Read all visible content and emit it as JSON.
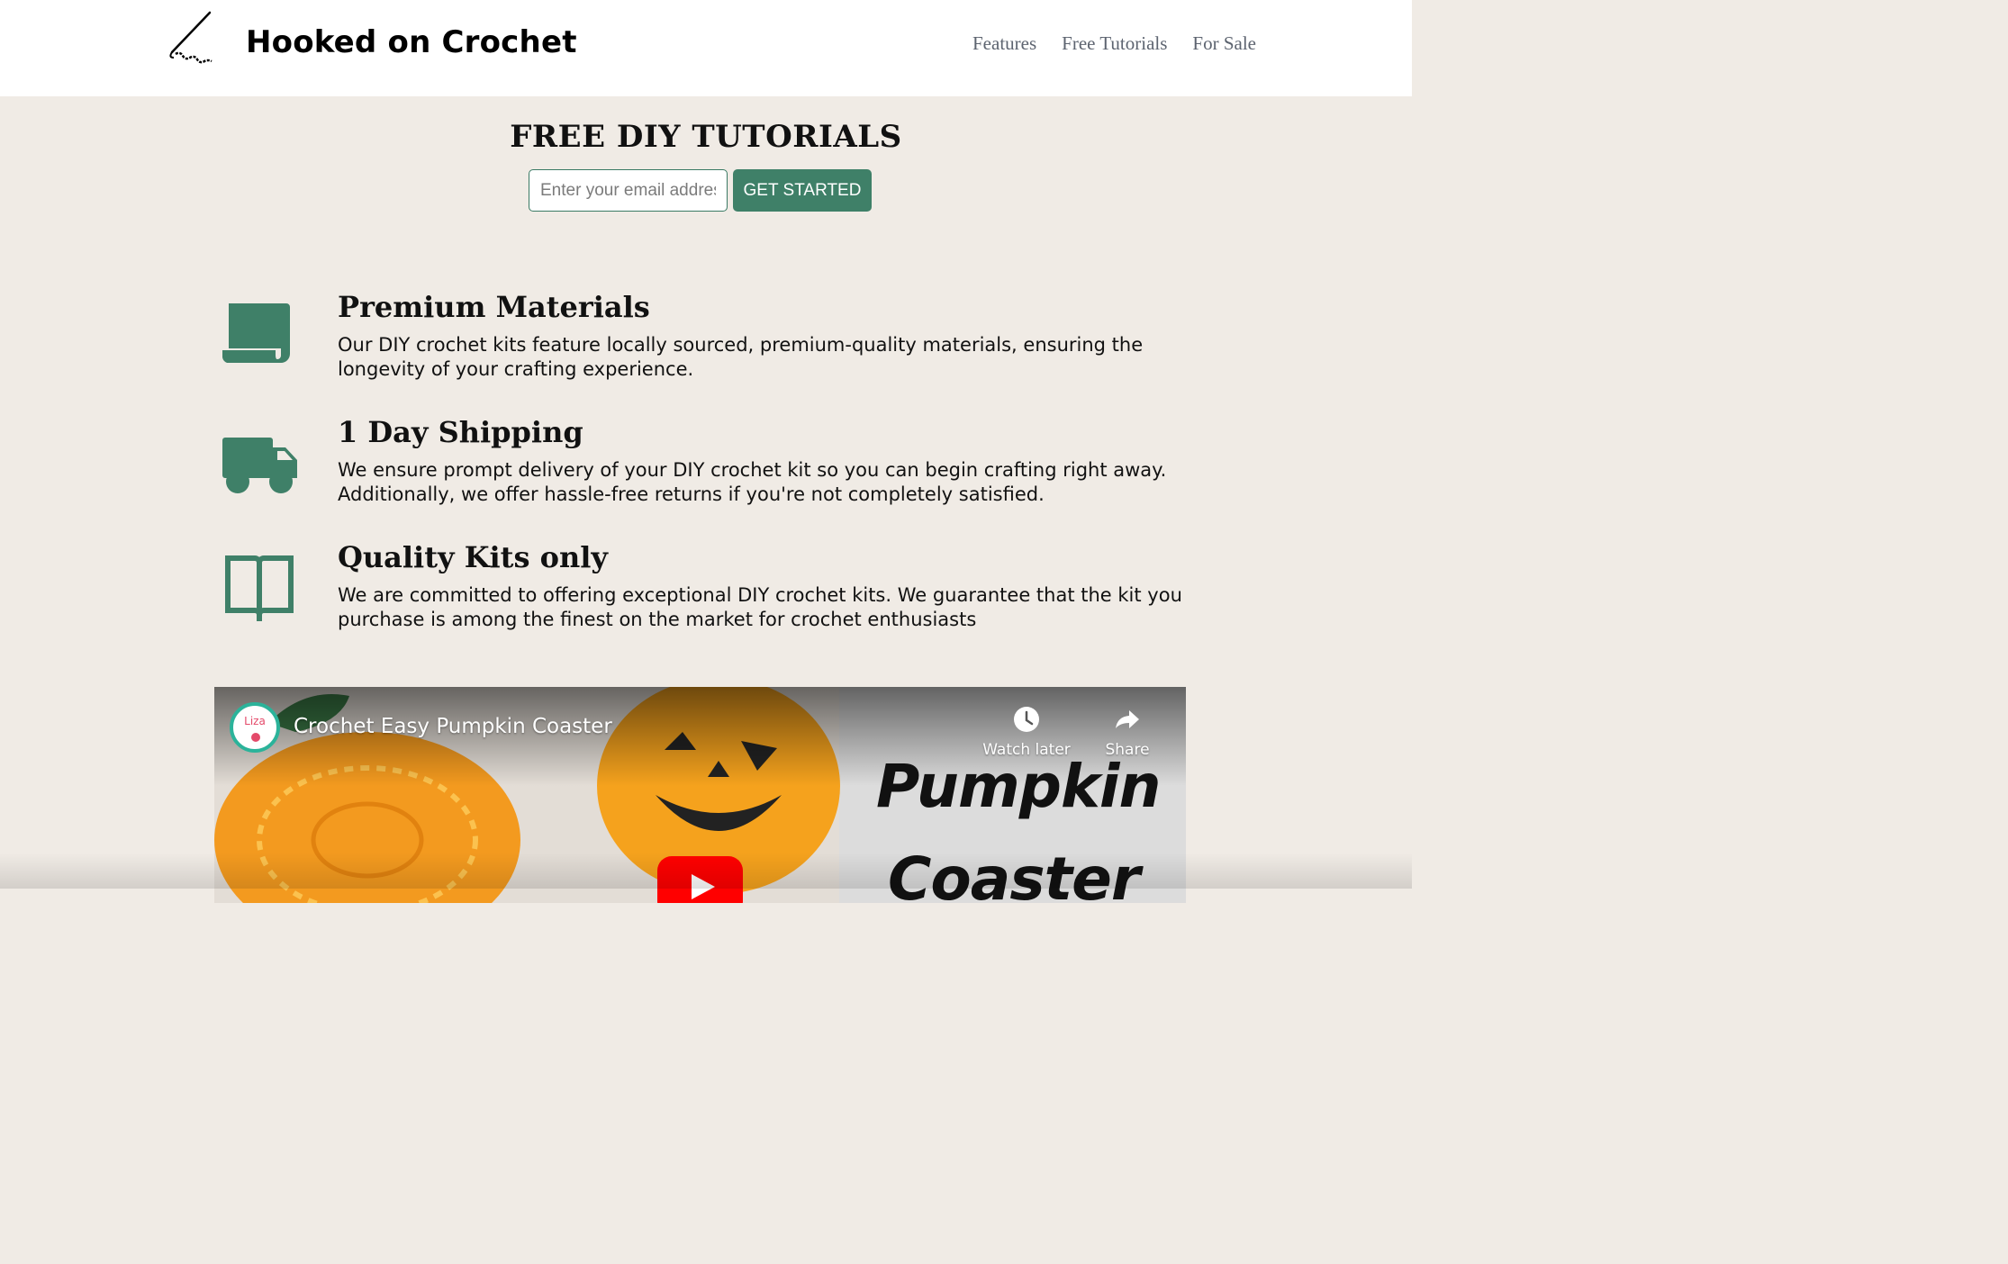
{
  "header": {
    "brand": "Hooked on Crochet",
    "nav": [
      "Features",
      "Free Tutorials",
      "For Sale"
    ]
  },
  "hero": {
    "title": "FREE DIY TUTORIALS",
    "email_placeholder": "Enter your email address",
    "cta_label": "GET STARTED"
  },
  "features": [
    {
      "icon": "scroll-icon",
      "title": "Premium Materials",
      "text": "Our DIY crochet kits feature locally sourced, premium-quality materials, ensuring the longevity of your crafting experience."
    },
    {
      "icon": "truck-icon",
      "title": "1 Day Shipping",
      "text": "We ensure prompt delivery of your DIY crochet kit so you can begin crafting right away. Additionally, we offer hassle-free returns if you're not completely satisfied."
    },
    {
      "icon": "book-open-icon",
      "title": "Quality Kits only",
      "text": "We are committed to offering exceptional DIY crochet kits. We guarantee that the kit you purchase is among the finest on the market for crochet enthusiasts"
    }
  ],
  "video": {
    "channel": "Liza",
    "title": "Crochet Easy Pumpkin Coaster",
    "watch_later": "Watch later",
    "share": "Share",
    "thumb_text_line1": "Pumpkin",
    "thumb_text_line2": "Coaster"
  },
  "colors": {
    "accent": "#3f8068",
    "background": "#f0ebe5",
    "header_bg": "#ffffff",
    "nav_text": "#5d6470"
  }
}
